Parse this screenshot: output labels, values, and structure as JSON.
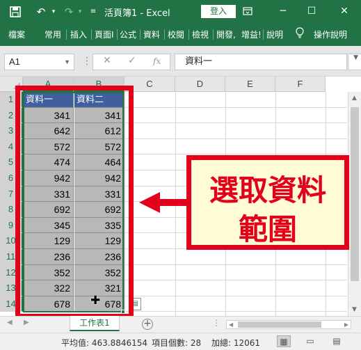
{
  "titlebar": {
    "title": "活頁簿1 - Excel",
    "signin_label": "登入",
    "colors": {
      "accent": "#217346"
    }
  },
  "ribbon": {
    "tabs": [
      "檔案",
      "常用",
      "插入",
      "頁面I",
      "公式",
      "資料",
      "校閱",
      "檢視",
      "開發,",
      "增益!",
      "說明"
    ],
    "tell_me": "操作說明"
  },
  "formula_bar": {
    "name_box": "A1",
    "fx_label": "fx",
    "formula": "資料一"
  },
  "grid": {
    "columns": [
      "A",
      "B",
      "C",
      "D",
      "E",
      "F"
    ],
    "rows": [
      "1",
      "2",
      "3",
      "4",
      "5",
      "6",
      "7",
      "8",
      "9",
      "10",
      "11",
      "12",
      "13",
      "14"
    ],
    "headers": [
      "資料一",
      "資料二"
    ],
    "data": [
      [
        "341",
        "341"
      ],
      [
        "642",
        "612"
      ],
      [
        "572",
        "572"
      ],
      [
        "474",
        "464"
      ],
      [
        "942",
        "942"
      ],
      [
        "331",
        "331"
      ],
      [
        "692",
        "692"
      ],
      [
        "345",
        "335"
      ],
      [
        "129",
        "129"
      ],
      [
        "236",
        "236"
      ],
      [
        "352",
        "352"
      ],
      [
        "322",
        "321"
      ],
      [
        "678",
        "678"
      ]
    ],
    "selected_range_color": "#217346",
    "header_fill": "#3f5f9e",
    "data_fill": "#b8b8b8"
  },
  "annotation": {
    "line1": "選取資料",
    "line2": "範圍",
    "color": "#e3001b",
    "fill": "#fefbd5"
  },
  "sheets": {
    "active": "工作表1"
  },
  "statusbar": {
    "average": "平均值: 463.8846154",
    "count": "項目個數: 28",
    "sum": "加總: 12061"
  }
}
